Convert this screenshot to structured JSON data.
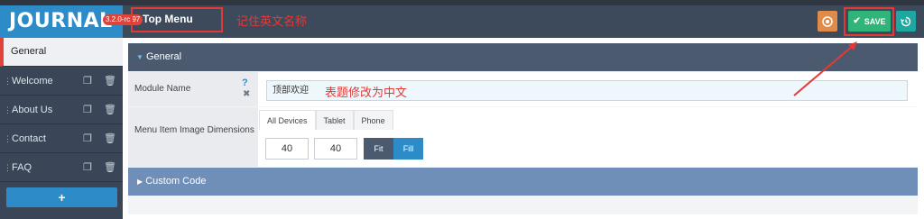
{
  "app": {
    "logo": "JOURNAL",
    "version": "3.2.0-rc.97",
    "module_title": "Top Menu"
  },
  "annotations": {
    "title_note": "记住英文名称",
    "field_note": "表题修改为中文"
  },
  "header": {
    "save_label": "SAVE",
    "preview_icon": "target-icon",
    "history_icon": "history-icon"
  },
  "sidebar": {
    "items": [
      {
        "label": "General"
      },
      {
        "label": "Welcome"
      },
      {
        "label": "About Us"
      },
      {
        "label": "Contact"
      },
      {
        "label": "FAQ"
      }
    ],
    "add_label": "+"
  },
  "panel": {
    "title": "General",
    "module_name_label": "Module Name",
    "module_name_value": "顶部欢迎",
    "image_dim_label": "Menu Item Image Dimensions",
    "tabs": [
      "All Devices",
      "Tablet",
      "Phone"
    ],
    "active_tab": "All Devices",
    "width_value": "40",
    "height_value": "40",
    "fit_label": "Fit",
    "fill_label": "Fill",
    "custom_code_label": "Custom Code"
  },
  "colors": {
    "accent_blue": "#2d8cc8",
    "save_green": "#2fb57a",
    "annotation_red": "#e53935"
  }
}
